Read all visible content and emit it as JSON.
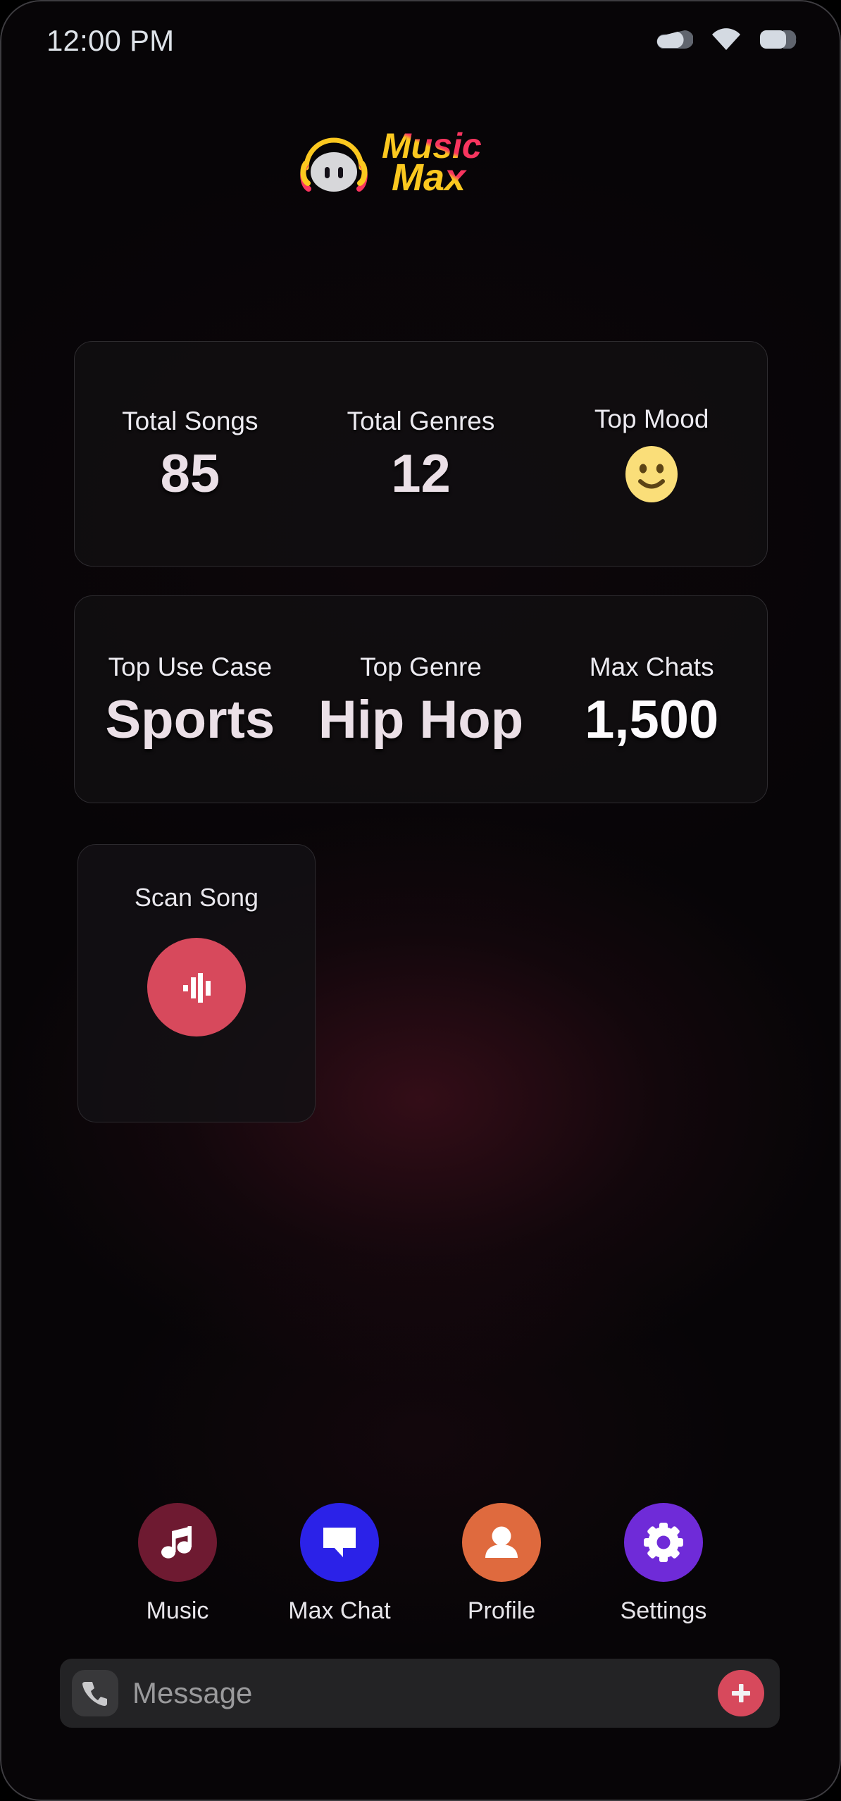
{
  "status_bar": {
    "time": "12:00 PM",
    "icons": [
      "cellular-signal-icon",
      "wifi-icon",
      "battery-icon"
    ]
  },
  "brand": {
    "mark": "robot-headphones-icon",
    "word_top": "Music",
    "word_bottom": "Max",
    "colors": {
      "pink": "#f8355f",
      "yellow": "#fbc81f",
      "robot_face": "#d7d7da"
    }
  },
  "overview_card": {
    "cells": [
      {
        "label": "Total Songs",
        "value": "85",
        "icon": ""
      },
      {
        "label": "Total Genres",
        "value": "12",
        "icon": ""
      },
      {
        "label": "Top Mood",
        "value": "🙂",
        "icon": "smiling-face-icon"
      }
    ]
  },
  "insights_card": {
    "cells": [
      {
        "label": "Top Use Case",
        "value": "Sports"
      },
      {
        "label": "Top Genre",
        "value": "Hip Hop"
      },
      {
        "label": "Max Chats",
        "value": "1,500"
      }
    ]
  },
  "scan": {
    "label": "Scan Song",
    "button_icon": "audio-waveform-icon",
    "button_color": "#d7495c"
  },
  "bottom_nav": [
    {
      "label": "Music",
      "icon": "music-note-icon",
      "color": "#6e1a31"
    },
    {
      "label": "Max Chat",
      "icon": "speech-bubble-icon",
      "color": "#2b22e8"
    },
    {
      "label": "Profile",
      "icon": "person-icon",
      "color": "#df6a3e"
    },
    {
      "label": "Settings",
      "icon": "gear-icon",
      "color": "#6f2bd8"
    }
  ],
  "message_bar": {
    "phone_icon": "phone-icon",
    "placeholder": "Message",
    "value": "",
    "add_icon": "plus-icon",
    "add_color": "#d7495c"
  }
}
